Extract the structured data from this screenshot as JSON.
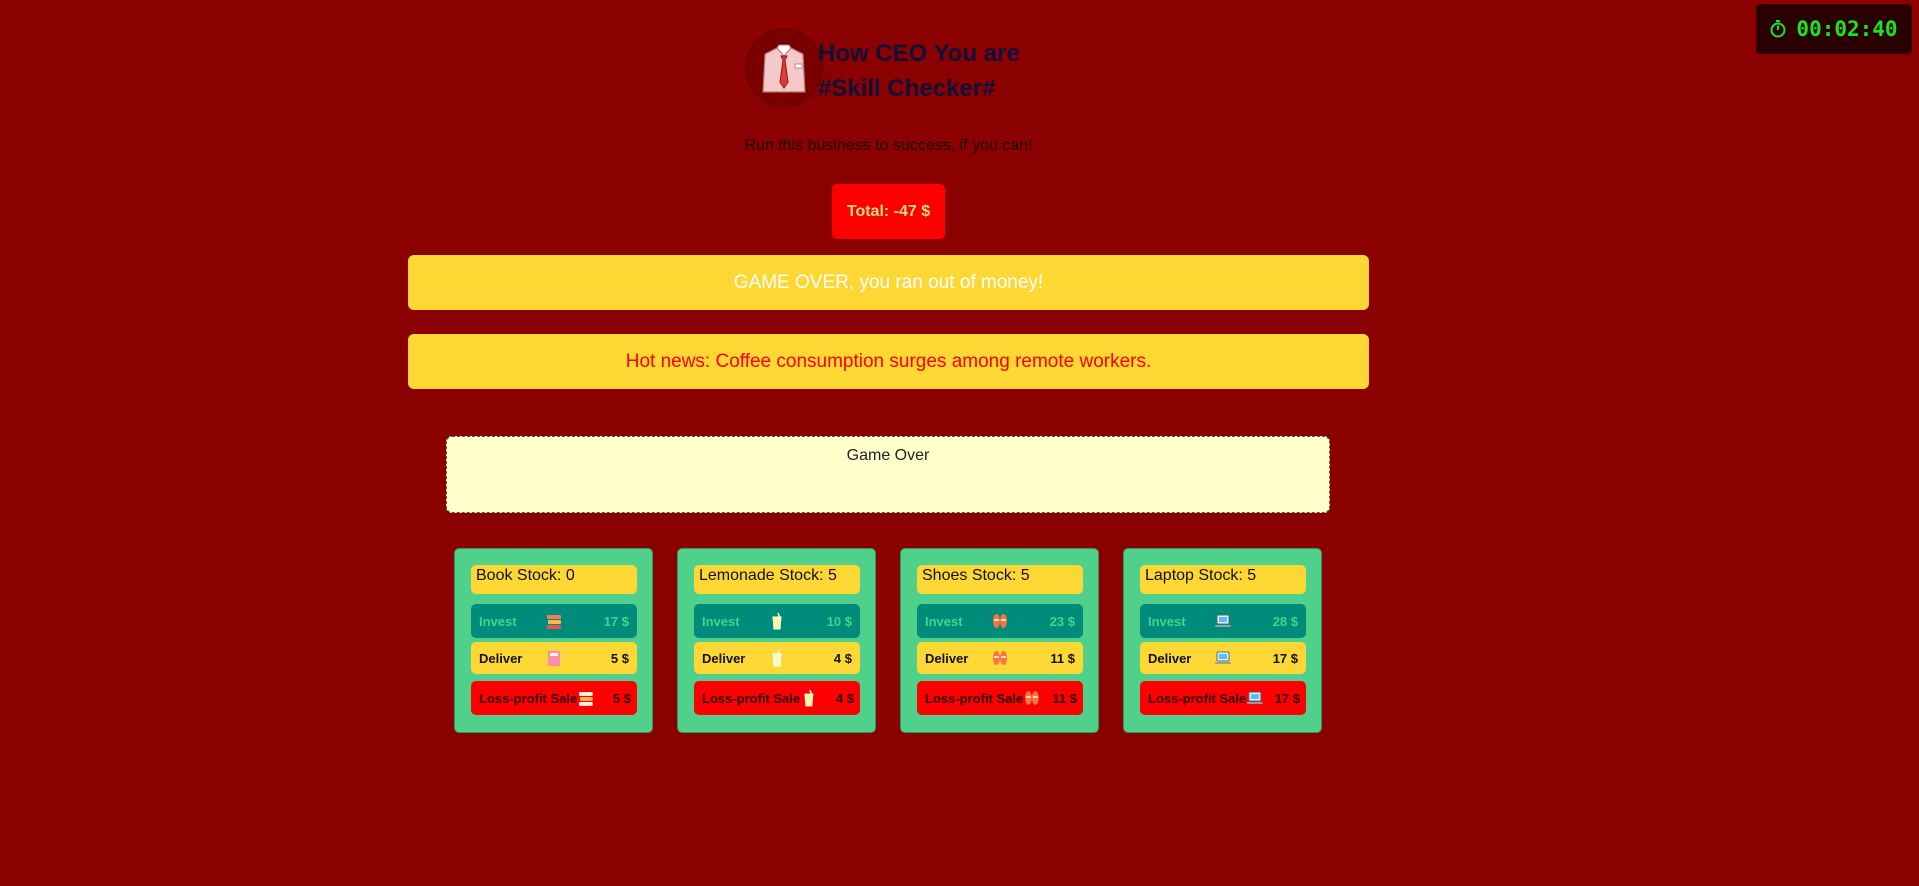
{
  "timer": {
    "icon": "stopwatch-icon",
    "value": "00:02:40"
  },
  "header": {
    "logo_icon": "shirt-tie-icon",
    "title_line1": "How CEO You are",
    "title_line2": "#Skill Checker#",
    "subtitle": "Run this business to success, if you can!"
  },
  "total": {
    "label": "Total: -47 $"
  },
  "banners": {
    "game_over": "GAME OVER, you ran out of money!",
    "news": "Hot news: Coffee consumption surges among remote workers."
  },
  "status_box": {
    "text": "Game Over"
  },
  "products": [
    {
      "stock_label": "Book Stock: 0",
      "icon": "book-icon",
      "invest_label": "Invest",
      "invest_price": "17 $",
      "deliver_label": "Deliver",
      "deliver_price": "5 $",
      "sale_label": "Loss-profit Sale",
      "sale_price": "5 $"
    },
    {
      "stock_label": "Lemonade Stock: 5",
      "icon": "lemonade-icon",
      "invest_label": "Invest",
      "invest_price": "10 $",
      "deliver_label": "Deliver",
      "deliver_price": "4 $",
      "sale_label": "Loss-profit Sale",
      "sale_price": "4 $"
    },
    {
      "stock_label": "Shoes Stock: 5",
      "icon": "shoes-icon",
      "invest_label": "Invest",
      "invest_price": "23 $",
      "deliver_label": "Deliver",
      "deliver_price": "11 $",
      "sale_label": "Loss-profit Sale",
      "sale_price": "11 $"
    },
    {
      "stock_label": "Laptop Stock: 5",
      "icon": "laptop-icon",
      "invest_label": "Invest",
      "invest_price": "28 $",
      "deliver_label": "Deliver",
      "deliver_price": "17 $",
      "sale_label": "Loss-profit Sale",
      "sale_price": "17 $"
    }
  ],
  "colors": {
    "background": "#8b0000",
    "banner": "#fdd835",
    "card": "#4fd18b",
    "invest": "#008b7a",
    "sale": "#ff0000",
    "timer_text": "#19e619"
  }
}
